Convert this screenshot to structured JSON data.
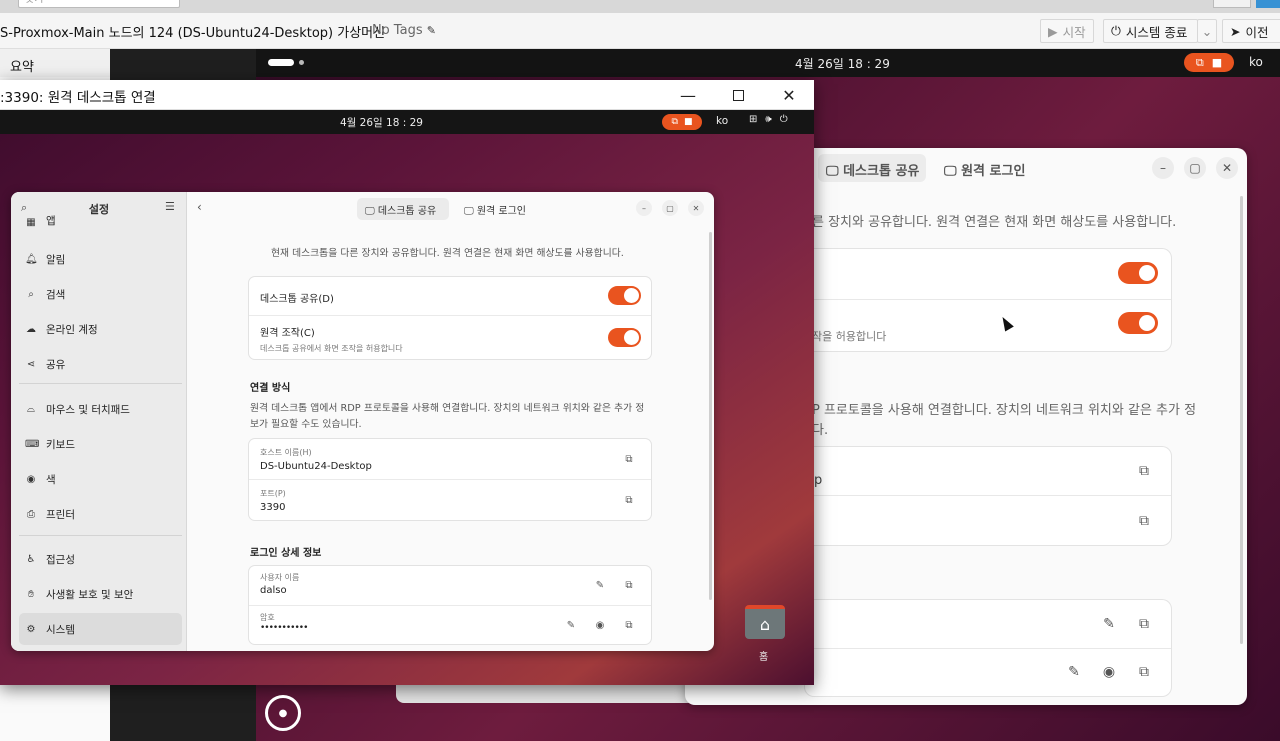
{
  "proxmox": {
    "search_placeholder": "찾기",
    "vm_title": "S-Proxmox-Main 노드의 124 (DS-Ubuntu24-Desktop) 가상머신",
    "tags": "No Tags",
    "start_button": "시작",
    "shutdown_button": "시스템 종료",
    "migrate_button": "이전",
    "summary_tab": "요약"
  },
  "outer_desktop": {
    "clock": "4월 26일  18 : 29",
    "language": "ko"
  },
  "rdp_window": {
    "title": ":3390: 원격 데스크톱 연결"
  },
  "inner_desktop": {
    "clock": "4월 26일  18 : 29",
    "language": "ko",
    "home_label": "홈"
  },
  "settings": {
    "sidebar_title": "설정",
    "sidebar_items": [
      {
        "label": "앱",
        "icon": "apps-icon"
      },
      {
        "label": "알림",
        "icon": "bell-icon"
      },
      {
        "label": "검색",
        "icon": "search-icon"
      },
      {
        "label": "온라인 계정",
        "icon": "cloud-icon"
      },
      {
        "label": "공유",
        "icon": "share-icon"
      },
      {
        "label": "마우스 및 터치패드",
        "icon": "mouse-icon"
      },
      {
        "label": "키보드",
        "icon": "keyboard-icon"
      },
      {
        "label": "색",
        "icon": "color-icon"
      },
      {
        "label": "프린터",
        "icon": "printer-icon"
      },
      {
        "label": "접근성",
        "icon": "accessibility-icon"
      },
      {
        "label": "사생활 보호 및 보안",
        "icon": "hand-icon"
      },
      {
        "label": "시스템",
        "icon": "system-icon"
      }
    ],
    "tabs": {
      "desktop_sharing": "데스크톱 공유",
      "remote_login": "원격 로그인"
    },
    "intro": "현재 데스크톱을 다른 장치와 공유합니다. 원격 연결은 현재 화면 해상도를 사용합니다.",
    "desktop_sharing_label": "데스크톱 공유(D)",
    "remote_control_label": "원격 조작(C)",
    "remote_control_sub": "데스크톱 공유에서 화면 조작을 허용합니다",
    "connection_heading": "연결 방식",
    "connection_desc_1": "원격 데스크톱 앱에서 RDP 프로토콜을 사용해 연결합니다. 장치의 네트워크 위치와 같은 추가 정",
    "connection_desc_2": "보가 필요할 수도 있습니다.",
    "hostname_label": "호스트 이름(H)",
    "hostname_value": "DS-Ubuntu24-Desktop",
    "port_label": "포트(P)",
    "port_value": "3390",
    "login_heading": "로그인 상세 정보",
    "username_label": "사용자 이름",
    "username_value": "dalso",
    "password_label": "암호",
    "password_value": "•••••••••••"
  },
  "bg_settings": {
    "intro_fragment": "른 장치와 공유합니다. 원격 연결은 현재 화면 해상도를 사용합니다.",
    "sub_fragment": "작을 허용합니다",
    "desc_fragment_1": "P 프로토콜을 사용해 연결합니다. 장치의 네트워크 위치와 같은 추가 정",
    "desc_fragment_2": "다.",
    "host_fragment": "p"
  },
  "colors": {
    "accent": "#e9541f",
    "toggle_on": "#e9541f"
  }
}
